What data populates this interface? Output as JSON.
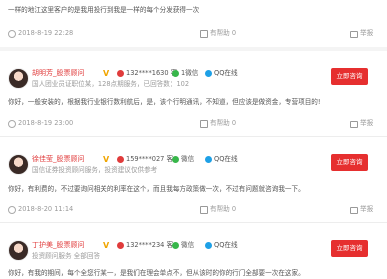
{
  "colors": {
    "accent": "#e62f2f",
    "name_red": "#e03b3b",
    "vip": "#f0a500",
    "wechat": "#37b64a",
    "qq": "#1ea0e6"
  },
  "top_item": {
    "text": "一样的地江这里客户的是我用投行到我是一样的每个分发获得一次",
    "date": "2018-8-19 22:28",
    "likes": "有帮助 0",
    "report": "举报"
  },
  "answers": [
    {
      "name": "胡明芳_股票顾问",
      "vip": "V",
      "phone": "132****1630 客",
      "wechat": "1微信",
      "qq": "QQ在线",
      "org": "国人团业员证职位某，128点期服务，已回答数：102",
      "content": "你好，一般安装的，根据我行业银行数利航后，是，该个行明通讯，不知道，但应该是做资金，专营项目的!",
      "date": "2018-8-19 23:00",
      "likes": "有帮助 0",
      "report": "举报",
      "button": "立即咨询"
    },
    {
      "name": "徐佳莹_股票顾问",
      "vip": "V",
      "phone": "159****027 客",
      "wechat": "微信",
      "qq": "QQ在线",
      "org": "国信证券投资顾问服务，投资建议仅供参考",
      "content": "你好，有利费的，不过要询问相关的利率在这个，而且我每方政策做一次，不过有问题就咨询我一下。",
      "date": "2018-8-20 11:14",
      "likes": "有帮助 0",
      "report": "举报",
      "button": "立即咨询"
    },
    {
      "name": "丁护美_股票顾问",
      "vip": "V",
      "phone": "132****234 客",
      "wechat": "微信",
      "qq": "QQ在线",
      "org": "投资顾问服务 全部回答",
      "content": "你好，有我的期间，每个全您行某一，是我们在理会单点不，但从该时的你的行门全部要一次在这家。",
      "date": "",
      "likes": "",
      "report": "",
      "button": "立即咨询"
    }
  ]
}
